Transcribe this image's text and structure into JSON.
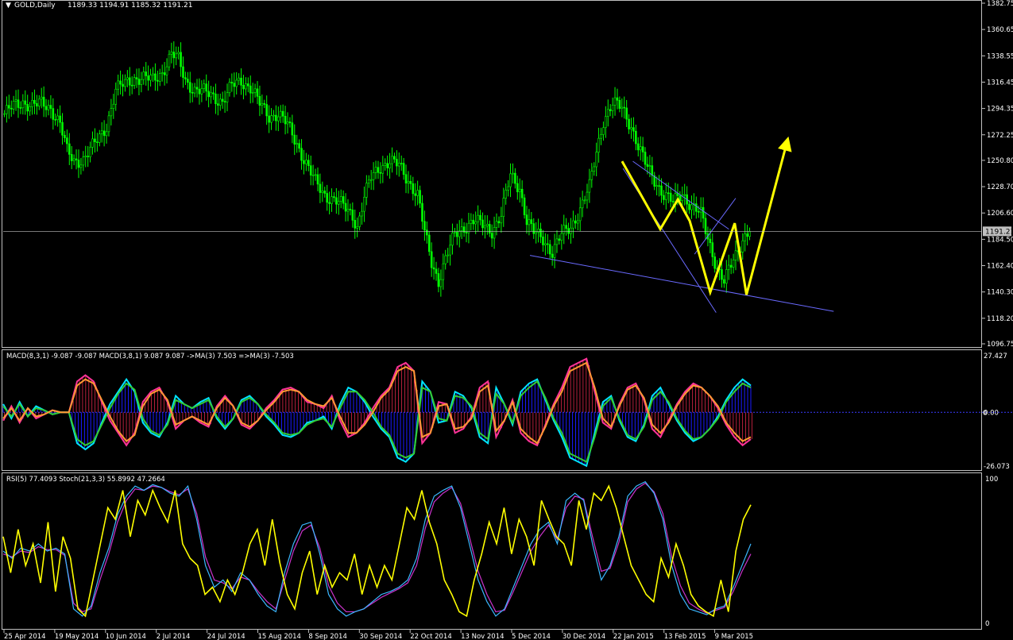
{
  "header": {
    "main_label": "GOLD,Daily",
    "main_ohlc": "1189.33 1194.91 1185.32 1191.21",
    "macd_label": "MACD(8,3,1) -9.087 -9.087  MACD(3,8,1) 9.087 9.087  ->MA(3) 7.503  =>MA(3) -7.503",
    "osc_label": "RSI(5) 77.4093  Stoch(21,3,3) 55.8992 47.2664"
  },
  "colors": {
    "background": "#000000",
    "candle": "#00ff00",
    "frame": "#c0c0c0",
    "text": "#ffffff",
    "annotation_arrow": "#ffff00",
    "trendline": "#6a6aff",
    "macd_cyan": "#00e5ff",
    "macd_pink": "#ff3399",
    "macd_green": "#33cc33",
    "macd_orange": "#ff9933",
    "macd_hist_blue": "#1a1aff",
    "macd_hist_red": "#ff2d55",
    "rsi": "#ffff00",
    "stoch_main": "#3ab7ff",
    "stoch_signal": "#cc33cc"
  },
  "chart_data": [
    {
      "type": "candlestick",
      "name": "GOLD,Daily",
      "ylim": [
        1096.75,
        1382.75
      ],
      "y_ticks": [
        1382.75,
        1360.65,
        1338.55,
        1316.45,
        1294.35,
        1272.25,
        1250.8,
        1228.7,
        1206.6,
        1184.5,
        1162.4,
        1140.3,
        1118.2,
        1096.75
      ],
      "y_tick_labels": [
        "1382.75",
        "1360.65",
        "1338.55",
        "1316.45",
        "1294.35",
        "1272.25",
        "1250.80",
        "1228.70",
        "1206.60",
        "1184.50",
        "1162.40",
        "1140.30",
        "1118.20",
        "1096.75"
      ],
      "current_price": 1191.21,
      "current_price_label": "1191.21",
      "price_waypoints": [
        [
          0,
          1290
        ],
        [
          4,
          1296
        ],
        [
          8,
          1300
        ],
        [
          12,
          1297
        ],
        [
          16,
          1298
        ],
        [
          20,
          1295
        ],
        [
          24,
          1282
        ],
        [
          27,
          1258
        ],
        [
          30,
          1250
        ],
        [
          34,
          1252
        ],
        [
          38,
          1262
        ],
        [
          41,
          1270
        ],
        [
          44,
          1280
        ],
        [
          48,
          1310
        ],
        [
          52,
          1315
        ],
        [
          56,
          1320
        ],
        [
          60,
          1320
        ],
        [
          64,
          1318
        ],
        [
          68,
          1325
        ],
        [
          72,
          1340
        ],
        [
          75,
          1335
        ],
        [
          78,
          1318
        ],
        [
          82,
          1310
        ],
        [
          86,
          1308
        ],
        [
          90,
          1305
        ],
        [
          94,
          1300
        ],
        [
          98,
          1313
        ],
        [
          102,
          1318
        ],
        [
          106,
          1312
        ],
        [
          110,
          1298
        ],
        [
          114,
          1288
        ],
        [
          118,
          1290
        ],
        [
          122,
          1280
        ],
        [
          126,
          1265
        ],
        [
          130,
          1248
        ],
        [
          134,
          1232
        ],
        [
          138,
          1222
        ],
        [
          142,
          1218
        ],
        [
          146,
          1212
        ],
        [
          150,
          1205
        ],
        [
          152,
          1195
        ],
        [
          155,
          1220
        ],
        [
          158,
          1236
        ],
        [
          162,
          1246
        ],
        [
          166,
          1250
        ],
        [
          170,
          1246
        ],
        [
          174,
          1234
        ],
        [
          178,
          1222
        ],
        [
          181,
          1190
        ],
        [
          184,
          1165
        ],
        [
          187,
          1150
        ],
        [
          190,
          1168
        ],
        [
          194,
          1188
        ],
        [
          198,
          1195
        ],
        [
          202,
          1200
        ],
        [
          206,
          1196
        ],
        [
          210,
          1192
        ],
        [
          214,
          1205
        ],
        [
          218,
          1238
        ],
        [
          222,
          1228
        ],
        [
          225,
          1200
        ],
        [
          228,
          1190
        ],
        [
          232,
          1185
        ],
        [
          236,
          1174
        ],
        [
          240,
          1188
        ],
        [
          244,
          1195
        ],
        [
          248,
          1210
        ],
        [
          252,
          1228
        ],
        [
          255,
          1258
        ],
        [
          258,
          1285
        ],
        [
          262,
          1298
        ],
        [
          266,
          1295
        ],
        [
          270,
          1280
        ],
        [
          273,
          1262
        ],
        [
          276,
          1248
        ],
        [
          280,
          1235
        ],
        [
          284,
          1222
        ],
        [
          288,
          1215
        ],
        [
          292,
          1224
        ],
        [
          296,
          1212
        ],
        [
          300,
          1205
        ],
        [
          304,
          1180
        ],
        [
          307,
          1160
        ],
        [
          310,
          1148
        ],
        [
          314,
          1168
        ],
        [
          318,
          1185
        ],
        [
          321,
          1191
        ]
      ],
      "bar_count": 322,
      "trendlines": [
        [
          [
            0.541,
            1171
          ],
          [
            0.851,
            1124
          ]
        ],
        [
          [
            0.646,
            1250
          ],
          [
            0.744,
            1193
          ]
        ],
        [
          [
            0.636,
            1244
          ],
          [
            0.731,
            1123
          ]
        ],
        [
          [
            0.709,
            1172
          ],
          [
            0.751,
            1219
          ]
        ]
      ],
      "arrows": [
        [
          [
            0.635,
            1250
          ],
          [
            0.674,
            1193
          ],
          [
            0.692,
            1218
          ],
          [
            0.704,
            1200
          ],
          [
            0.725,
            1140
          ],
          [
            0.75,
            1198
          ],
          [
            0.762,
            1138
          ],
          [
            0.803,
            1265
          ]
        ]
      ]
    },
    {
      "type": "line",
      "name": "MACD",
      "ylim": [
        -26.073,
        27.427
      ],
      "y_tick_labels": [
        "27.427",
        "0.00",
        "-26.073"
      ],
      "zero_label": "0",
      "series": [
        {
          "name": "MACD(8,3,1)",
          "color": "#00e5ff",
          "values": [
            4,
            -3,
            5,
            -2,
            3,
            1,
            -1,
            0,
            0,
            -15,
            -18,
            -15,
            -5,
            4,
            10,
            16,
            10,
            -5,
            -10,
            -12,
            -5,
            8,
            4,
            2,
            5,
            7,
            -3,
            -8,
            -3,
            6,
            8,
            4,
            -2,
            -6,
            -11,
            -12,
            -10,
            -5,
            -4,
            -2,
            -8,
            4,
            12,
            10,
            5,
            -2,
            -8,
            -12,
            -22,
            -24,
            -20,
            15,
            10,
            -5,
            -4,
            10,
            8,
            2,
            -12,
            -15,
            12,
            4,
            -6,
            10,
            14,
            16,
            6,
            -4,
            -12,
            -22,
            -24,
            -26,
            -10,
            5,
            8,
            -4,
            -12,
            -14,
            -6,
            8,
            12,
            4,
            -4,
            -10,
            -14,
            -12,
            -8,
            -2,
            6,
            12,
            16,
            13
          ]
        },
        {
          "name": "MACD(3,8,1)",
          "color": "#ff3399",
          "values": [
            -4,
            3,
            -5,
            2,
            -3,
            -1,
            1,
            0,
            0,
            15,
            18,
            15,
            5,
            -4,
            -10,
            -16,
            -10,
            5,
            10,
            12,
            5,
            -8,
            -4,
            -2,
            -5,
            -7,
            3,
            8,
            3,
            -6,
            -8,
            -4,
            2,
            6,
            11,
            12,
            10,
            5,
            4,
            2,
            8,
            -4,
            -12,
            -10,
            -5,
            2,
            8,
            12,
            22,
            24,
            20,
            -15,
            -10,
            5,
            4,
            -10,
            -8,
            -2,
            12,
            15,
            -12,
            -4,
            6,
            -10,
            -14,
            -16,
            -6,
            4,
            12,
            22,
            24,
            26,
            10,
            -5,
            -8,
            4,
            12,
            14,
            6,
            -8,
            -12,
            -4,
            4,
            10,
            14,
            12,
            8,
            2,
            -6,
            -12,
            -16,
            -13
          ]
        },
        {
          "name": "->MA(3)",
          "color": "#33cc33",
          "values": [
            3,
            -2,
            4,
            -2,
            2,
            1,
            -1,
            0,
            0,
            -13,
            -16,
            -14,
            -6,
            2,
            9,
            14,
            11,
            -3,
            -9,
            -11,
            -6,
            6,
            4,
            2,
            4,
            6,
            -2,
            -7,
            -3,
            5,
            7,
            4,
            -1,
            -5,
            -10,
            -11,
            -10,
            -6,
            -4,
            -3,
            -7,
            2,
            10,
            10,
            6,
            0,
            -7,
            -11,
            -20,
            -22,
            -20,
            12,
            10,
            -3,
            -4,
            8,
            7,
            3,
            -10,
            -13,
            9,
            4,
            -5,
            8,
            12,
            15,
            7,
            -3,
            -10,
            -20,
            -22,
            -24,
            -12,
            3,
            7,
            -3,
            -11,
            -13,
            -7,
            6,
            10,
            5,
            -3,
            -9,
            -13,
            -12,
            -8,
            -3,
            5,
            10,
            14,
            12
          ]
        },
        {
          "name": "=>MA(3)",
          "color": "#ff9933",
          "values": [
            -3,
            2,
            -4,
            2,
            -2,
            -1,
            1,
            0,
            0,
            13,
            16,
            14,
            6,
            -2,
            -9,
            -14,
            -11,
            3,
            9,
            11,
            6,
            -6,
            -4,
            -2,
            -4,
            -6,
            2,
            7,
            3,
            -5,
            -7,
            -4,
            1,
            5,
            10,
            11,
            10,
            6,
            4,
            3,
            7,
            -2,
            -10,
            -10,
            -6,
            0,
            7,
            11,
            20,
            22,
            20,
            -12,
            -10,
            3,
            4,
            -8,
            -7,
            -3,
            10,
            13,
            -9,
            -4,
            5,
            -8,
            -12,
            -15,
            -7,
            3,
            10,
            20,
            22,
            24,
            12,
            -3,
            -7,
            3,
            11,
            13,
            7,
            -6,
            -10,
            -5,
            3,
            9,
            13,
            12,
            8,
            3,
            -5,
            -10,
            -14,
            -12
          ]
        }
      ]
    },
    {
      "type": "line",
      "name": "RSI / Stochastic",
      "ylim": [
        0,
        100
      ],
      "y_tick_labels": [
        "100",
        "0"
      ],
      "series": [
        {
          "name": "RSI(5)",
          "color": "#ffff00",
          "values": [
            60,
            35,
            65,
            40,
            55,
            28,
            70,
            22,
            60,
            45,
            10,
            5,
            30,
            55,
            80,
            72,
            92,
            60,
            85,
            75,
            92,
            80,
            70,
            92,
            55,
            45,
            40,
            20,
            25,
            15,
            30,
            20,
            35,
            55,
            65,
            40,
            72,
            42,
            20,
            10,
            35,
            50,
            20,
            40,
            25,
            35,
            30,
            48,
            20,
            40,
            25,
            40,
            30,
            55,
            80,
            72,
            92,
            70,
            55,
            30,
            20,
            8,
            5,
            30,
            48,
            70,
            55,
            80,
            48,
            72,
            60,
            40,
            85,
            72,
            60,
            55,
            40,
            85,
            65,
            90,
            85,
            95,
            80,
            60,
            40,
            30,
            20,
            15,
            45,
            32,
            55,
            40,
            20,
            12,
            8,
            5,
            30,
            8,
            50,
            72,
            82
          ]
        },
        {
          "name": "Stoch(21,3,3)",
          "color": "#3ab7ff",
          "values": [
            50,
            45,
            52,
            50,
            55,
            50,
            52,
            48,
            10,
            5,
            12,
            35,
            52,
            75,
            88,
            95,
            92,
            96,
            94,
            90,
            88,
            95,
            72,
            40,
            25,
            30,
            22,
            35,
            30,
            20,
            12,
            8,
            35,
            55,
            68,
            70,
            48,
            20,
            10,
            5,
            8,
            10,
            15,
            20,
            22,
            25,
            30,
            45,
            72,
            88,
            92,
            95,
            80,
            55,
            30,
            15,
            5,
            10,
            25,
            40,
            55,
            65,
            70,
            55,
            85,
            90,
            85,
            55,
            30,
            40,
            60,
            88,
            95,
            98,
            90,
            72,
            40,
            20,
            10,
            8,
            6,
            10,
            12,
            25,
            40,
            55
          ]
        },
        {
          "name": "Stoch signal",
          "color": "#cc33cc",
          "values": [
            48,
            46,
            50,
            49,
            53,
            51,
            51,
            47,
            14,
            8,
            10,
            30,
            48,
            70,
            85,
            93,
            92,
            95,
            94,
            91,
            89,
            93,
            76,
            46,
            30,
            28,
            24,
            32,
            30,
            22,
            15,
            10,
            30,
            50,
            64,
            68,
            52,
            26,
            14,
            8,
            8,
            10,
            14,
            18,
            21,
            24,
            28,
            40,
            66,
            84,
            90,
            94,
            83,
            60,
            36,
            20,
            8,
            9,
            22,
            36,
            50,
            60,
            68,
            58,
            80,
            88,
            86,
            60,
            36,
            38,
            56,
            84,
            93,
            97,
            91,
            76,
            46,
            26,
            14,
            10,
            7,
            9,
            11,
            22,
            36,
            48
          ]
        }
      ]
    }
  ],
  "x_axis": {
    "tick_labels": [
      "25 Apr 2014",
      "19 May 2014",
      "10 Jun 2014",
      "2 Jul 2014",
      "24 Jul 2014",
      "15 Aug 2014",
      "8 Sep 2014",
      "30 Sep 2014",
      "22 Oct 2014",
      "13 Nov 2014",
      "5 Dec 2014",
      "30 Dec 2014",
      "22 Jan 2015",
      "13 Feb 2015",
      "9 Mar 2015"
    ]
  }
}
